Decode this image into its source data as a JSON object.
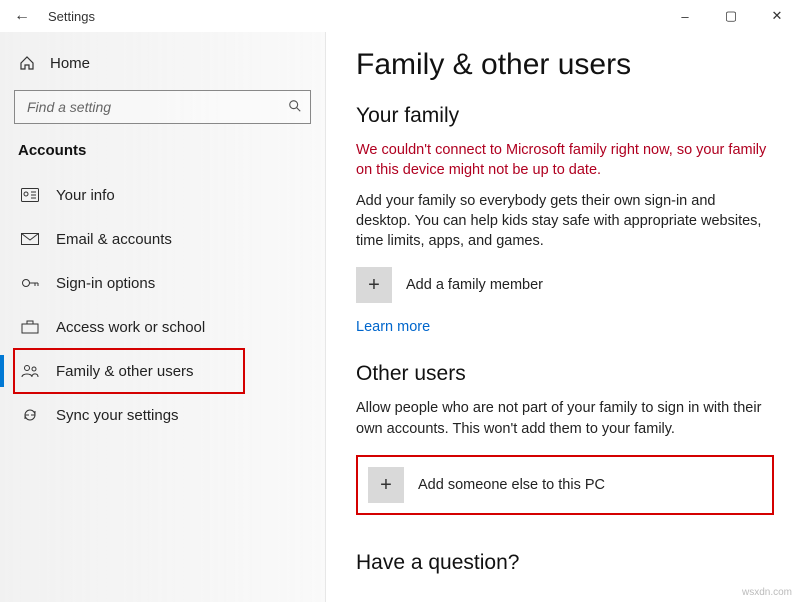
{
  "window": {
    "title": "Settings",
    "minimize": "–",
    "maximize": "▢",
    "close": "✕"
  },
  "sidebar": {
    "home": "Home",
    "search_placeholder": "Find a setting",
    "section": "Accounts",
    "items": [
      {
        "label": "Your info"
      },
      {
        "label": "Email & accounts"
      },
      {
        "label": "Sign-in options"
      },
      {
        "label": "Access work or school"
      },
      {
        "label": "Family & other users"
      },
      {
        "label": "Sync your settings"
      }
    ]
  },
  "main": {
    "title": "Family & other users",
    "family_heading": "Your family",
    "family_error": "We couldn't connect to Microsoft family right now, so your family on this device might not be up to date.",
    "family_body": "Add your family so everybody gets their own sign-in and desktop. You can help kids stay safe with appropriate websites, time limits, apps, and games.",
    "add_family": "Add a family member",
    "learn_more": "Learn more",
    "other_heading": "Other users",
    "other_body": "Allow people who are not part of your family to sign in with their own accounts. This won't add them to your family.",
    "add_other": "Add someone else to this PC",
    "question_heading": "Have a question?"
  },
  "watermark": "wsxdn.com"
}
